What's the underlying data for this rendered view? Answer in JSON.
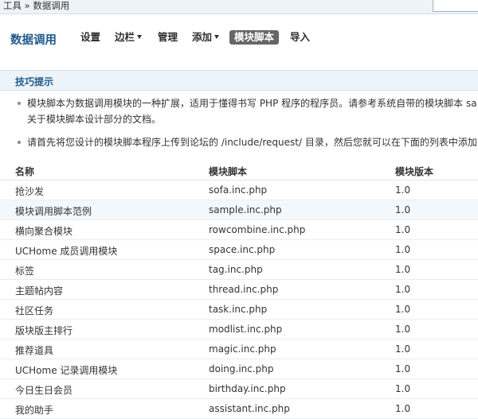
{
  "breadcrumb": {
    "text": "工具 » 数据调用"
  },
  "header": {
    "title": "数据调用",
    "nav": [
      {
        "label": "设置",
        "dropdown": false,
        "active": false
      },
      {
        "label": "边栏",
        "dropdown": true,
        "active": false
      },
      {
        "label": "管理",
        "dropdown": false,
        "active": false
      },
      {
        "label": "添加",
        "dropdown": true,
        "active": false
      },
      {
        "label": "模块脚本",
        "dropdown": false,
        "active": true
      },
      {
        "label": "导入",
        "dropdown": false,
        "active": false
      }
    ]
  },
  "tips": {
    "title": "技巧提示",
    "item1_line1": "模块脚本为数据调用模块的一种扩展，适用于懂得书写 PHP 程序的程序员。请参考系统自带的模块脚本 sa",
    "item1_line2": "关于模块脚本设计部分的文档。",
    "item2": "请首先将您设计的模块脚本程序上传到论坛的 /include/request/ 目录，然后您就可以在下面的列表中添加"
  },
  "table": {
    "headers": {
      "name": "名称",
      "script": "模块脚本",
      "version": "模块版本"
    },
    "rows": [
      {
        "name": "抢沙发",
        "script": "sofa.inc.php",
        "version": "1.0"
      },
      {
        "name": "模块调用脚本范例",
        "script": "sample.inc.php",
        "version": "1.0"
      },
      {
        "name": "横向聚合模块",
        "script": "rowcombine.inc.php",
        "version": "1.0"
      },
      {
        "name": "UCHome 成员调用模块",
        "script": "space.inc.php",
        "version": "1.0"
      },
      {
        "name": "标签",
        "script": "tag.inc.php",
        "version": "1.0"
      },
      {
        "name": "主题帖内容",
        "script": "thread.inc.php",
        "version": "1.0"
      },
      {
        "name": "社区任务",
        "script": "task.inc.php",
        "version": "1.0"
      },
      {
        "name": "版块版主排行",
        "script": "modlist.inc.php",
        "version": "1.0"
      },
      {
        "name": "推荐道具",
        "script": "magic.inc.php",
        "version": "1.0"
      },
      {
        "name": "UCHome 记录调用模块",
        "script": "doing.inc.php",
        "version": "1.0"
      },
      {
        "name": "今日生日会员",
        "script": "birthday.inc.php",
        "version": "1.0"
      },
      {
        "name": "我的助手",
        "script": "assistant.inc.php",
        "version": "1.0"
      }
    ]
  },
  "colors": {
    "accent": "#1f5a8d",
    "active_tab_bg": "#666666",
    "tips_bg": "#ecf3f9",
    "alt_row_bg": "#f3f8fc"
  },
  "icons": {
    "dropdown": "chevron-down-icon",
    "bullet": "bullet-icon"
  }
}
